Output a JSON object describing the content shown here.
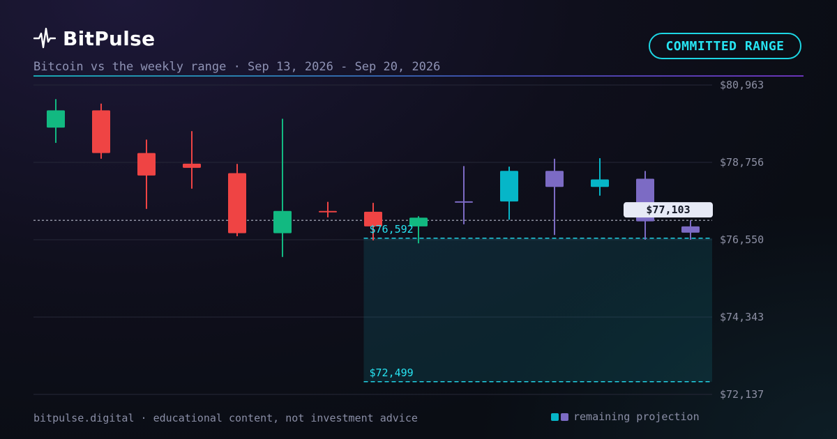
{
  "brand": {
    "name": "BitPulse"
  },
  "header": {
    "subtitle": "Bitcoin vs the weekly range · Sep 13, 2026 - Sep 20, 2026",
    "badge": "COMMITTED RANGE"
  },
  "footer": {
    "note": "bitpulse.digital · educational content, not investment advice",
    "legend_label": "remaining projection"
  },
  "colors": {
    "up": "#12b981",
    "down": "#ef4444",
    "proj_up": "#06b6c8",
    "proj_down": "#7c6bc4",
    "range": "#22d3e6",
    "accent": "#27e4f2"
  },
  "chart_data": {
    "type": "candlestick",
    "y_ticks": [
      "$80,963",
      "$78,756",
      "$76,550",
      "$74,343",
      "$72,137"
    ],
    "y_tick_values": [
      80963,
      78756,
      76550,
      74343,
      72137
    ],
    "ylim": [
      72137,
      80963
    ],
    "current_price": 77103,
    "current_price_label": "$77,103",
    "range": {
      "upper": 76592,
      "upper_label": "$76,592",
      "lower": 72499,
      "lower_label": "$72,499",
      "start_index": 7
    },
    "candles": [
      {
        "open": 79747,
        "close": 80240,
        "high": 80560,
        "low": 79312,
        "kind": "actual"
      },
      {
        "open": 80240,
        "close": 79023,
        "high": 80432,
        "low": 78860,
        "kind": "actual"
      },
      {
        "open": 79023,
        "close": 78381,
        "high": 79405,
        "low": 77429,
        "kind": "actual"
      },
      {
        "open": 78718,
        "close": 78601,
        "high": 79647,
        "low": 78006,
        "kind": "actual"
      },
      {
        "open": 78448,
        "close": 76736,
        "high": 78712,
        "low": 76650,
        "kind": "actual"
      },
      {
        "open": 76736,
        "close": 77370,
        "high": 80000,
        "low": 76057,
        "kind": "actual"
      },
      {
        "open": 77370,
        "close": 77348,
        "high": 77630,
        "low": 77187,
        "kind": "actual"
      },
      {
        "open": 77348,
        "close": 76930,
        "high": 77601,
        "low": 76530,
        "kind": "actual"
      },
      {
        "open": 76930,
        "close": 77178,
        "high": 77220,
        "low": 76446,
        "kind": "actual"
      },
      {
        "open": 77645,
        "close": 77640,
        "high": 78650,
        "low": 76990,
        "kind": "projection"
      },
      {
        "open": 77640,
        "close": 78514,
        "high": 78634,
        "low": 77120,
        "kind": "projection"
      },
      {
        "open": 78514,
        "close": 78055,
        "high": 78860,
        "low": 76685,
        "kind": "projection"
      },
      {
        "open": 78055,
        "close": 78270,
        "high": 78875,
        "low": 77807,
        "kind": "projection"
      },
      {
        "open": 78290,
        "close": 77075,
        "high": 78510,
        "low": 76550,
        "kind": "projection"
      },
      {
        "open": 76930,
        "close": 76752,
        "high": 77103,
        "low": 76550,
        "kind": "projection"
      }
    ]
  }
}
